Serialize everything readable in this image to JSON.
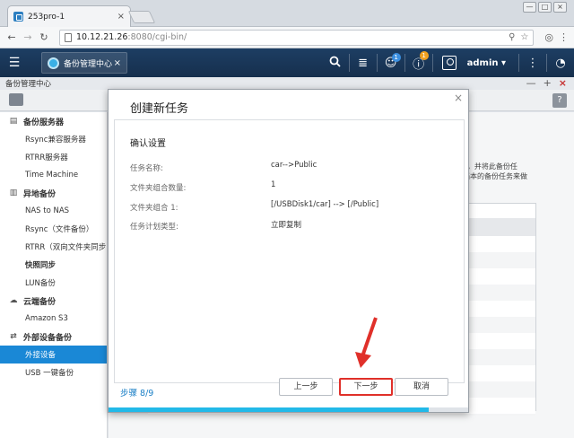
{
  "browser": {
    "tab_title": "253pro-1",
    "tab_close": "×",
    "url_host": "10.12.21.26",
    "url_rest": ":8080/cgi-bin/",
    "win_minimize": "—",
    "win_restore": "□",
    "win_close": "×"
  },
  "app": {
    "menu_icon": "☰",
    "tab_label": "备份管理中心",
    "tab_close": "×",
    "notification_badge": "1",
    "info_badge": "1",
    "username": "admin ▾",
    "subheader_title": "备份管理中心",
    "win_min": "—",
    "win_max": "+",
    "win_close": "×",
    "help": "?"
  },
  "sidebar": {
    "groups": [
      {
        "label": "备份服务器",
        "icon": "server-icon",
        "items": [
          {
            "label": "Rsync兼容服务器"
          },
          {
            "label": "RTRR服务器"
          },
          {
            "label": "Time Machine"
          }
        ]
      },
      {
        "label": "异地备份",
        "icon": "remote-backup-icon",
        "items": [
          {
            "label": "NAS to NAS"
          },
          {
            "label": "Rsync（文件备份）"
          },
          {
            "label": "RTRR（双向文件夹同步"
          },
          {
            "label": "快照同步",
            "bold": true
          },
          {
            "label": "LUN备份"
          }
        ]
      },
      {
        "label": "云端备份",
        "icon": "cloud-icon",
        "items": [
          {
            "label": "Amazon S3"
          }
        ]
      },
      {
        "label": "外部设备备份",
        "icon": "sync-icon",
        "items": [
          {
            "label": "外接设备",
            "active": true
          },
          {
            "label": "USB 一键备份"
          }
        ]
      }
    ]
  },
  "background": {
    "text_line1": "e，并将此备份任",
    "text_line2": "档本的备份任务来做"
  },
  "dialog": {
    "title": "创建新任务",
    "close": "×",
    "section_title": "确认设置",
    "fields": [
      {
        "label": "任务名称:",
        "value": "car-->Public"
      },
      {
        "label": "文件夹组合数量:",
        "value": "1"
      },
      {
        "label": "文件夹组合 1:",
        "value": "[/USBDisk1/car] --> [/Public]"
      },
      {
        "label": "任务计划类型:",
        "value": "立即复制"
      }
    ],
    "step_label": "步骤 8/9",
    "buttons": {
      "prev": "上一步",
      "next": "下一步",
      "cancel": "取消"
    },
    "progress": 0.89
  },
  "colors": {
    "accent": "#1a88d6",
    "header": "#1d3e63",
    "progress": "#22b9e8",
    "highlight": "#e0302a"
  }
}
